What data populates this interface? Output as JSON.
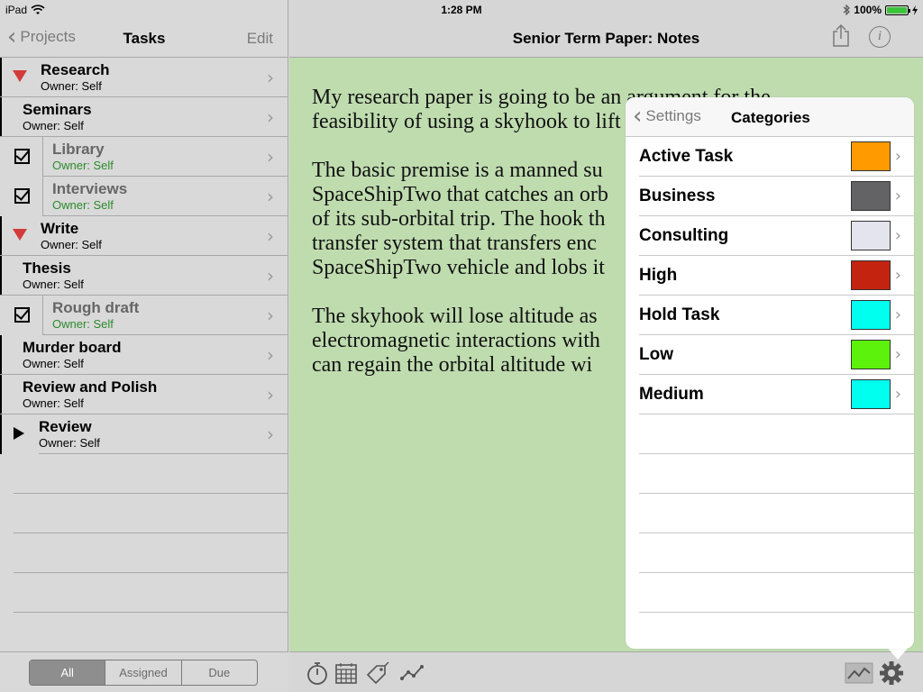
{
  "status_bar": {
    "device": "iPad",
    "time": "1:28 PM",
    "battery": "100%",
    "battery_level": 1.0
  },
  "left_nav": {
    "back_label": "Projects",
    "title": "Tasks",
    "edit_label": "Edit"
  },
  "tasks": [
    {
      "title": "Research",
      "owner": "Owner: Self",
      "marker": "triangle-down",
      "done": false
    },
    {
      "title": "Seminars",
      "owner": "Owner: Self",
      "marker": "none",
      "done": false
    },
    {
      "title": "Library",
      "owner": "Owner: Self",
      "marker": "checkbox",
      "done": true
    },
    {
      "title": "Interviews",
      "owner": "Owner: Self",
      "marker": "checkbox",
      "done": true
    },
    {
      "title": "Write",
      "owner": "Owner: Self",
      "marker": "triangle-down",
      "done": false
    },
    {
      "title": "Thesis",
      "owner": "Owner: Self",
      "marker": "none",
      "done": false
    },
    {
      "title": "Rough draft",
      "owner": "Owner: Self",
      "marker": "checkbox",
      "done": true
    },
    {
      "title": "Murder board",
      "owner": "Owner: Self",
      "marker": "none",
      "done": false
    },
    {
      "title": "Review and Polish",
      "owner": "Owner: Self",
      "marker": "none",
      "done": false
    },
    {
      "title": "Review",
      "owner": "Owner: Self",
      "marker": "triangle-right",
      "done": false
    }
  ],
  "filter": {
    "options": [
      "All",
      "Assigned",
      "Due"
    ],
    "selected": "All"
  },
  "note": {
    "title": "Senior Term Paper: Notes",
    "lines": [
      "My research paper is going to be an argument for the",
      "feasibility of using a skyhook to lift vehicles into orbit.",
      "",
      "The basic premise is a manned su",
      "SpaceShipTwo that catches an orb",
      "of its sub-orbital trip. The hook th",
      "transfer system that transfers enc",
      "SpaceShipTwo vehicle and lobs it",
      "",
      "The skyhook will lose altitude as",
      "electromagnetic interactions with",
      "can regain the orbital altitude wi"
    ]
  },
  "categories_popover": {
    "back_label": "Settings",
    "title": "Categories",
    "items": [
      {
        "name": "Active Task",
        "color": "#ff9a00"
      },
      {
        "name": "Business",
        "color": "#636366"
      },
      {
        "name": "Consulting",
        "color": "#e4e4ee"
      },
      {
        "name": "High",
        "color": "#c42310"
      },
      {
        "name": "Hold Task",
        "color": "#00ffee"
      },
      {
        "name": "Low",
        "color": "#5cf20c"
      },
      {
        "name": "Medium",
        "color": "#00ffee"
      }
    ]
  },
  "toolbar_icons": [
    "stopwatch-icon",
    "calendar-icon",
    "tag-icon",
    "chart-icon",
    "graph-view-icon",
    "gear-icon"
  ],
  "theme": {
    "note_background": "#bfdcaf",
    "done_owner_color": "#2c8a2c",
    "collapse_triangle_color": "#d33a3a"
  }
}
